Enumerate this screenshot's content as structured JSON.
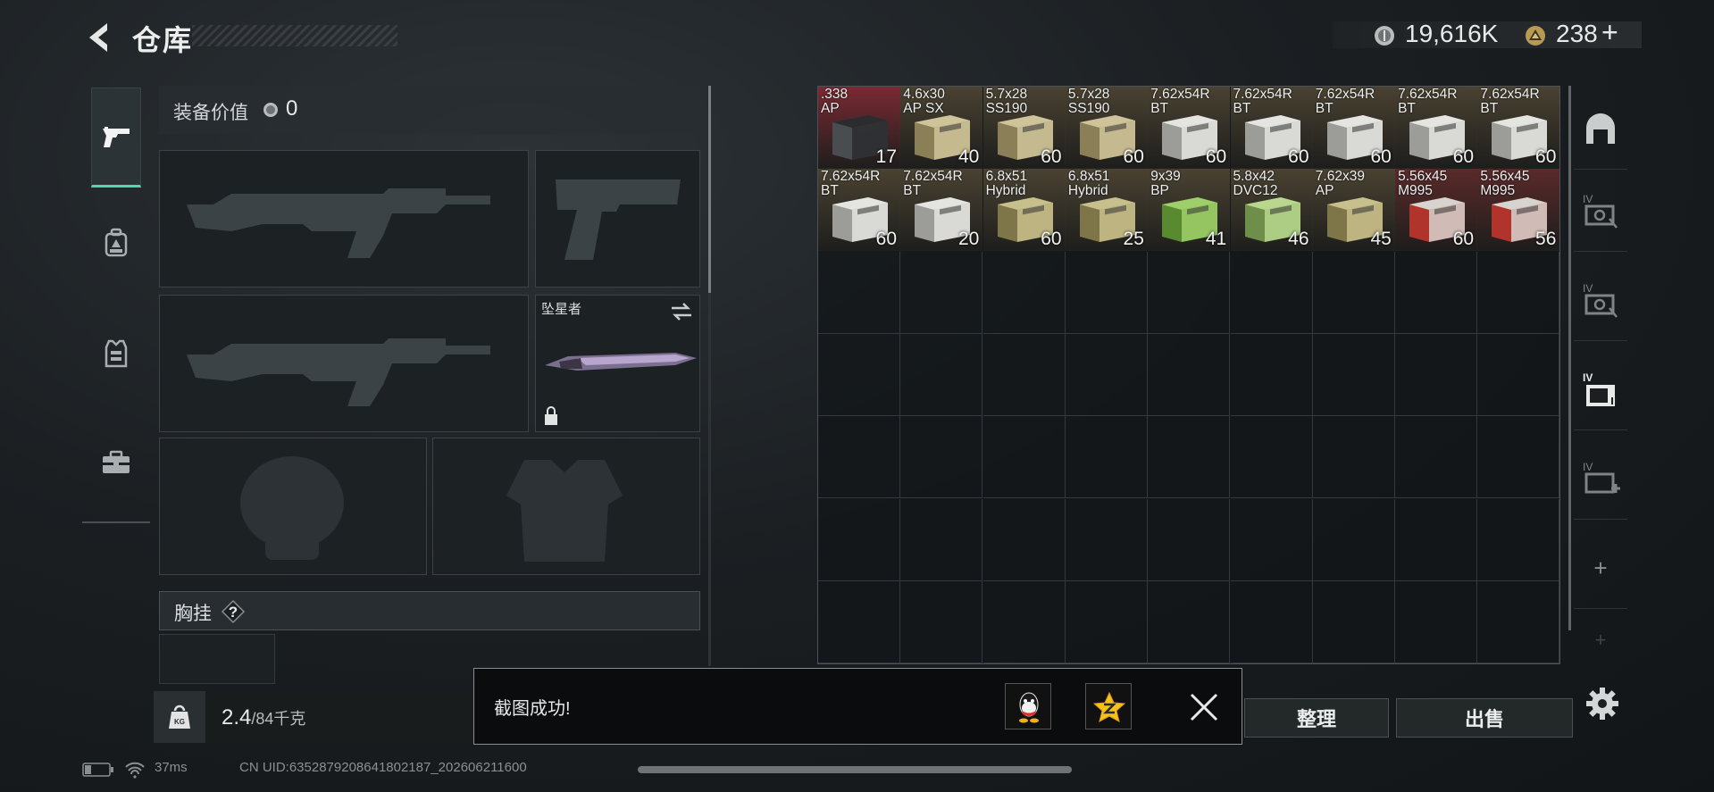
{
  "header": {
    "title": "仓库",
    "currency": {
      "coins": "19,616K",
      "gems": "238",
      "plus": "+"
    }
  },
  "left_nav": {
    "items": [
      {
        "icon": "pistol-icon",
        "active": true
      },
      {
        "icon": "backpack-icon",
        "active": false
      },
      {
        "icon": "vest-icon",
        "active": false
      },
      {
        "icon": "toolbox-icon",
        "active": false
      }
    ]
  },
  "equipment": {
    "value_label": "装备价值",
    "value": "0",
    "knife_name": "坠星者",
    "chest_label": "胸挂",
    "help_glyph": "?"
  },
  "weight": {
    "current": "2.4",
    "max": "/84千克",
    "icon_text": "KG"
  },
  "inventory": {
    "items": [
      {
        "name": ".338\nAP",
        "qty": "17",
        "color": "#7a2a33",
        "box": "dark"
      },
      {
        "name": "4.6x30\nAP SX",
        "qty": "40",
        "color": "#4a4232",
        "box": "tan"
      },
      {
        "name": "5.7x28\nSS190",
        "qty": "60",
        "color": "#4a4232",
        "box": "tan"
      },
      {
        "name": "5.7x28\nSS190",
        "qty": "60",
        "color": "#4a4232",
        "box": "tan"
      },
      {
        "name": "7.62x54R\nBT",
        "qty": "60",
        "color": "#4a4232",
        "box": "white"
      },
      {
        "name": "7.62x54R\nBT",
        "qty": "60",
        "color": "#4a4232",
        "box": "white"
      },
      {
        "name": "7.62x54R\nBT",
        "qty": "60",
        "color": "#4a4232",
        "box": "white"
      },
      {
        "name": "7.62x54R\nBT",
        "qty": "60",
        "color": "#4a4232",
        "box": "white"
      },
      {
        "name": "7.62x54R\nBT",
        "qty": "60",
        "color": "#4a4232",
        "box": "white"
      },
      {
        "name": "7.62x54R\nBT",
        "qty": "60",
        "color": "#4a4232",
        "box": "white"
      },
      {
        "name": "7.62x54R\nBT",
        "qty": "20",
        "color": "#4a4232",
        "box": "white"
      },
      {
        "name": "6.8x51\nHybrid",
        "qty": "60",
        "color": "#4a4232",
        "box": "olive"
      },
      {
        "name": "6.8x51\nHybrid",
        "qty": "25",
        "color": "#4a4232",
        "box": "olive"
      },
      {
        "name": "9x39\nBP",
        "qty": "41",
        "color": "#4a4232",
        "box": "green"
      },
      {
        "name": "5.8x42\nDVC12",
        "qty": "46",
        "color": "#4a4232",
        "box": "lime"
      },
      {
        "name": "7.62x39\nAP",
        "qty": "45",
        "color": "#4a4232",
        "box": "olive"
      },
      {
        "name": "5.56x45\nM995",
        "qty": "60",
        "color": "#5a2a2a",
        "box": "red"
      },
      {
        "name": "5.56x45\nM995",
        "qty": "56",
        "color": "#5a2a2a",
        "box": "red"
      }
    ]
  },
  "sidebar": {
    "items": [
      {
        "icon": "storage-door-icon"
      },
      {
        "icon": "case-iv-icon",
        "label": "IV"
      },
      {
        "icon": "case-iv-icon",
        "label": "IV"
      },
      {
        "icon": "folder-iv-icon",
        "label": "IV"
      },
      {
        "icon": "medkit-iv-icon",
        "label": "IV"
      },
      {
        "icon": "plus-icon",
        "label": "+"
      }
    ]
  },
  "buttons": {
    "sort": "整理",
    "sell": "出售"
  },
  "toast": {
    "message": "截图成功!"
  },
  "status": {
    "ping": "37ms",
    "uid": "CN UID:6352879208641802187_202606211600"
  }
}
